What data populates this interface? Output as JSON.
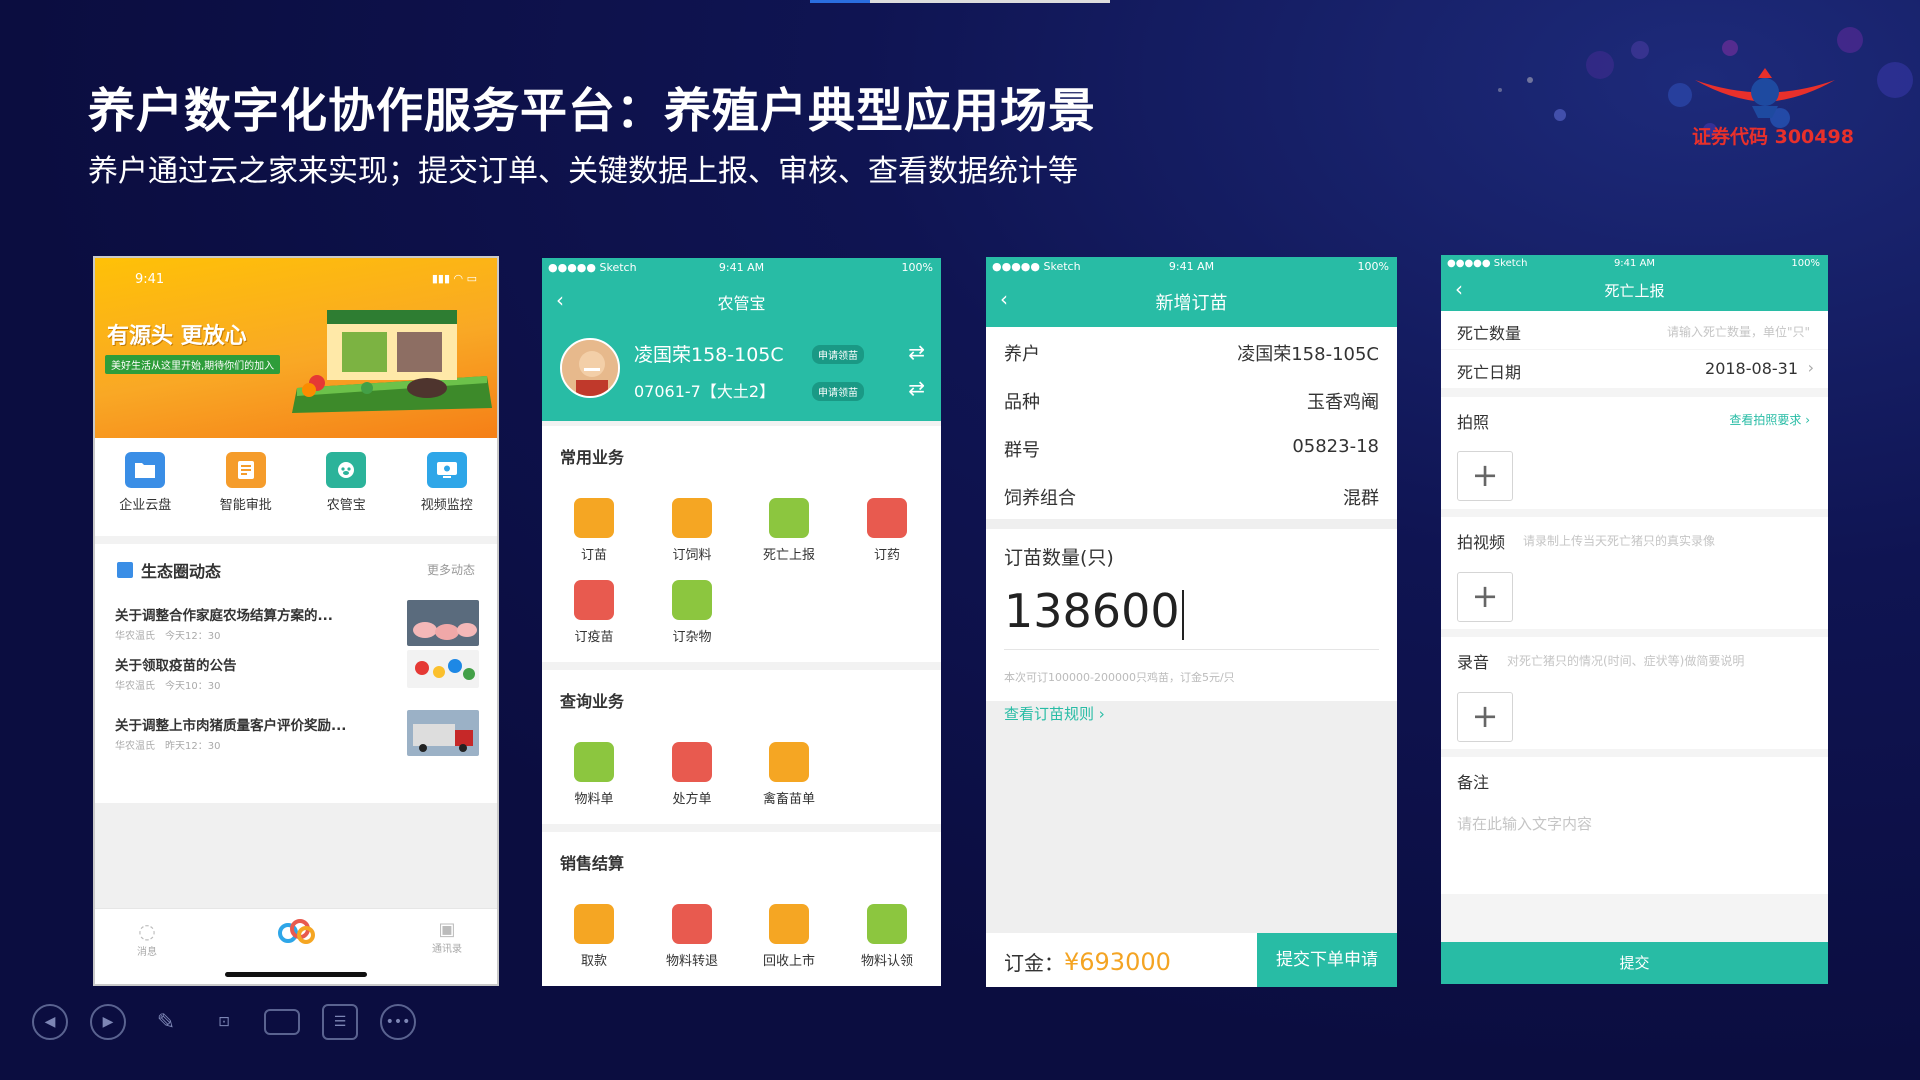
{
  "slide": {
    "title": "养户数字化协作服务平台：养殖户典型应用场景",
    "subtitle": "养户通过云之家来实现；提交订单、关键数据上报、审核、查看数据统计等",
    "logo_code": "证券代码 300498",
    "colors": {
      "background": "#0c0f45",
      "teal": "#28bca5",
      "logo_red": "#e8302b"
    }
  },
  "phone1": {
    "time": "9:41",
    "banner_slogan": "有源头 更放心",
    "banner_sub": "美好生活从这里开始,期待你们的加入",
    "apps": [
      {
        "label": "企业云盘",
        "icon": "folder-icon",
        "color": "#3a8ee6"
      },
      {
        "label": "智能审批",
        "icon": "approval-icon",
        "color": "#f59c2b"
      },
      {
        "label": "农管宝",
        "icon": "farm-icon",
        "color": "#2bb39a"
      },
      {
        "label": "视频监控",
        "icon": "monitor-icon",
        "color": "#2ea6e8"
      }
    ],
    "news_title": "生态圈动态",
    "news_more": "更多动态",
    "news": [
      {
        "title": "关于调整合作家庭农场结算方案的...",
        "meta": "华农温氏　今天12：30"
      },
      {
        "title": "关于领取疫苗的公告",
        "meta": "华农温氏　今天10：30"
      },
      {
        "title": "关于调整上市肉猪质量客户评价奖励...",
        "meta": "华农温氏　昨天12：30"
      }
    ],
    "tabs": [
      "消息",
      "",
      "通讯录"
    ]
  },
  "phone2": {
    "status": {
      "carrier": "●●●●● Sketch",
      "time": "9:41 AM",
      "battery": "100%"
    },
    "title": "农管宝",
    "user_name": "凌国荣158-105C",
    "user_code": "07061-7【大土2】",
    "pill": "申请领苗",
    "sections": [
      {
        "title": "常用业务",
        "items": [
          {
            "label": "订苗",
            "color": "#f5a623"
          },
          {
            "label": "订饲料",
            "color": "#f5a623"
          },
          {
            "label": "死亡上报",
            "color": "#8cc63f"
          },
          {
            "label": "订药",
            "color": "#e85a4f"
          },
          {
            "label": "订疫苗",
            "color": "#e85a4f"
          },
          {
            "label": "订杂物",
            "color": "#8cc63f"
          }
        ]
      },
      {
        "title": "查询业务",
        "items": [
          {
            "label": "物料单",
            "color": "#8cc63f"
          },
          {
            "label": "处方单",
            "color": "#e85a4f"
          },
          {
            "label": "禽畜苗单",
            "color": "#f5a623"
          }
        ]
      },
      {
        "title": "销售结算",
        "items": [
          {
            "label": "取款",
            "color": "#f5a623"
          },
          {
            "label": "物料转退",
            "color": "#e85a4f"
          },
          {
            "label": "回收上市",
            "color": "#f5a623"
          },
          {
            "label": "物料认领",
            "color": "#8cc63f"
          }
        ]
      }
    ]
  },
  "phone3": {
    "status": {
      "carrier": "●●●●● Sketch",
      "time": "9:41 AM",
      "battery": "100%"
    },
    "title": "新增订苗",
    "rows": [
      {
        "key": "养户",
        "value": "凌国荣158-105C"
      },
      {
        "key": "品种",
        "value": "玉香鸡阉"
      },
      {
        "key": "群号",
        "value": "05823-18"
      },
      {
        "key": "饲养组合",
        "value": "混群"
      }
    ],
    "qty_label": "订苗数量(只)",
    "qty_value": "138600",
    "qty_hint": "本次可订100000-200000只鸡苗，订金5元/只",
    "rule_link": "查看订苗规则",
    "deposit_label": "订金：",
    "deposit_value": "¥693000",
    "submit": "提交下单申请"
  },
  "phone4": {
    "status": {
      "carrier": "●●●●● Sketch",
      "time": "9:41 AM",
      "battery": "100%"
    },
    "title": "死亡上报",
    "death_count_label": "死亡数量",
    "death_count_placeholder": "请输入死亡数量，单位\"只\"",
    "death_date_label": "死亡日期",
    "death_date_value": "2018-08-31",
    "photo_label": "拍照",
    "photo_link": "查看拍照要求",
    "video_label": "拍视频",
    "video_hint": "请录制上传当天死亡猪只的真实录像",
    "audio_label": "录音",
    "audio_hint": "对死亡猪只的情况(时间、症状等)做简要说明",
    "remark_label": "备注",
    "remark_placeholder": "请在此输入文字内容",
    "submit": "提交"
  }
}
